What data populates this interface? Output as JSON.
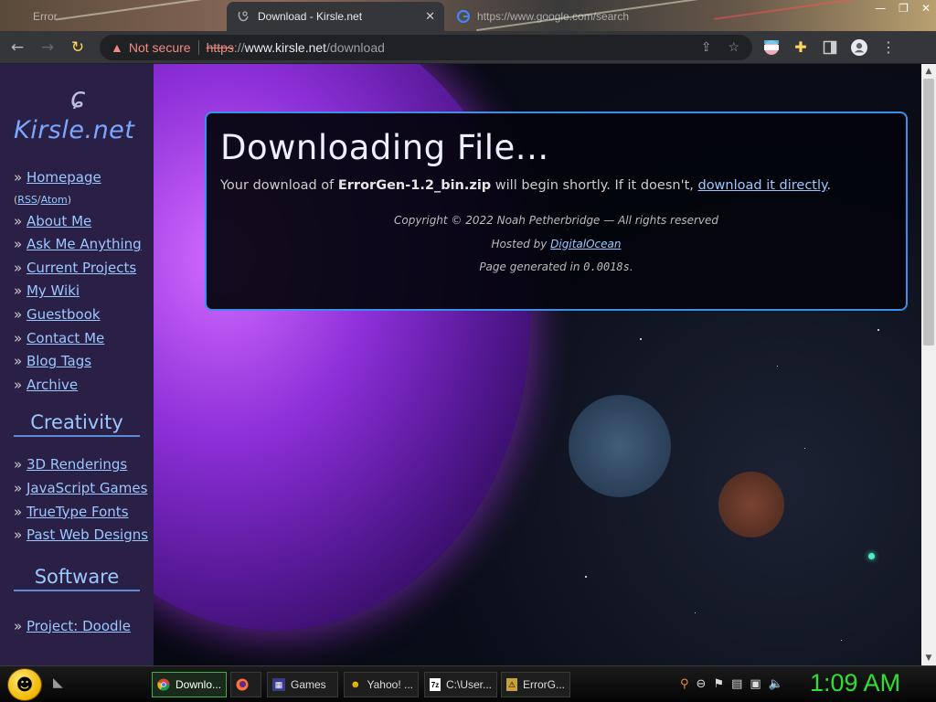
{
  "browser": {
    "tabs": [
      {
        "title": "Error",
        "active": false
      },
      {
        "title": "Download - Kirsle.net",
        "active": true
      },
      {
        "title": "https://www.google.com/search",
        "active": false
      }
    ],
    "security_label": "Not secure",
    "url": {
      "scheme": "https",
      "slashes": "://",
      "host": "www.kirsle.net",
      "path": "/download"
    }
  },
  "sidebar": {
    "logo": "Kirsle.net",
    "nav": [
      {
        "label": "Homepage"
      },
      {
        "label": "About Me"
      },
      {
        "label": "Ask Me Anything"
      },
      {
        "label": "Current Projects"
      },
      {
        "label": "My Wiki"
      },
      {
        "label": "Guestbook"
      },
      {
        "label": "Contact Me"
      },
      {
        "label": "Blog Tags"
      },
      {
        "label": "Archive"
      }
    ],
    "rss": {
      "rss": "RSS",
      "sep": "/",
      "atom": "Atom"
    },
    "creativity": {
      "heading": "Creativity",
      "items": [
        {
          "label": "3D Renderings"
        },
        {
          "label": "JavaScript Games"
        },
        {
          "label": "TrueType Fonts"
        },
        {
          "label": "Past Web Designs"
        }
      ]
    },
    "software": {
      "heading": "Software",
      "items": [
        {
          "label": "Project: Doodle"
        }
      ]
    }
  },
  "download": {
    "heading": "Downloading File...",
    "msg_prefix": "Your download of ",
    "filename": "ErrorGen-1.2_bin.zip",
    "msg_middle": " will begin shortly. If it doesn't, ",
    "link": "download it directly",
    "msg_suffix": ".",
    "copyright": "Copyright © 2022 Noah Petherbridge — All rights reserved",
    "hosted_prefix": "Hosted by ",
    "host_link": "DigitalOcean",
    "generated_prefix": "Page generated in ",
    "generated_time": "0.0018s",
    "generated_suffix": "."
  },
  "taskbar": {
    "tasks": [
      {
        "label": "Downlo...",
        "active": true,
        "icon": "chrome-icon"
      },
      {
        "label": "",
        "active": false,
        "icon": "firefox-icon"
      },
      {
        "label": "Games",
        "active": false,
        "icon": "games-icon"
      },
      {
        "label": "Yahoo! ...",
        "active": false,
        "icon": "yahoo-icon"
      },
      {
        "label": "C:\\User...",
        "active": false,
        "icon": "7zip-icon"
      },
      {
        "label": "ErrorG...",
        "active": false,
        "icon": "errorgen-icon"
      }
    ],
    "clock": "1:09 AM"
  },
  "colors": {
    "accent": "#3d8ee6",
    "link": "#9ac8ff",
    "clock": "#30e030",
    "planet": "#8c2fd8"
  }
}
